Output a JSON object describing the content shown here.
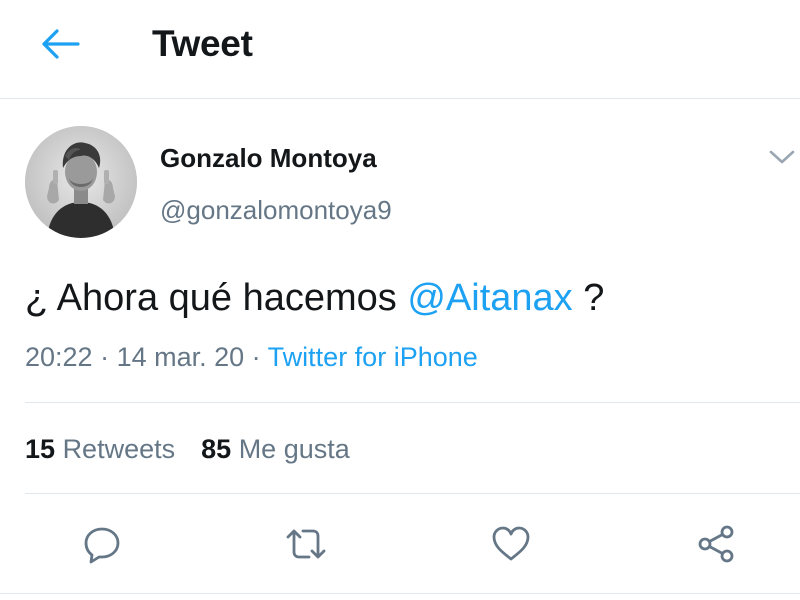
{
  "header": {
    "title": "Tweet",
    "back_icon": "arrow-left-icon",
    "accent_color": "#1da1f2"
  },
  "author": {
    "name": "Gonzalo Montoya",
    "handle": "@gonzalomontoya9",
    "menu_icon": "chevron-down-icon"
  },
  "tweet": {
    "text_before": "¿ Ahora qué hacemos ",
    "mention": "@Aitanax",
    "text_after": " ?",
    "time": "20:22",
    "separator": " · ",
    "date": "14 mar. 20",
    "source": "Twitter for iPhone"
  },
  "stats": {
    "retweets_count": "15",
    "retweets_label": "Retweets",
    "likes_count": "85",
    "likes_label": "Me gusta"
  },
  "actions": [
    {
      "name": "reply",
      "icon": "reply-icon"
    },
    {
      "name": "retweet",
      "icon": "retweet-icon"
    },
    {
      "name": "like",
      "icon": "heart-icon"
    },
    {
      "name": "share",
      "icon": "share-icon"
    }
  ],
  "colors": {
    "text_primary": "#14171a",
    "text_secondary": "#657786",
    "link": "#1da1f2",
    "divider": "#e1e8ed"
  }
}
